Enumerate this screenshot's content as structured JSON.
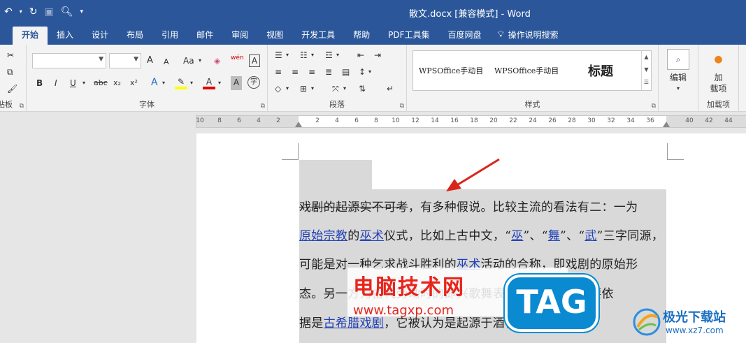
{
  "window": {
    "title": "散文.docx [兼容模式] - Word"
  },
  "qat": {
    "undo_icon": "undo-icon",
    "redo_icon": "redo-icon",
    "touch_icon": "touch-mode-icon",
    "preview_icon": "print-preview-icon",
    "customize_icon": "customize-qat-icon"
  },
  "tabs": [
    {
      "label": "开始",
      "active": true
    },
    {
      "label": "插入"
    },
    {
      "label": "设计"
    },
    {
      "label": "布局"
    },
    {
      "label": "引用"
    },
    {
      "label": "邮件"
    },
    {
      "label": "审阅"
    },
    {
      "label": "视图"
    },
    {
      "label": "开发工具"
    },
    {
      "label": "帮助"
    },
    {
      "label": "PDF工具集"
    },
    {
      "label": "百度网盘"
    },
    {
      "label": "操作说明搜索"
    }
  ],
  "ribbon": {
    "clipboard_label": "贴板",
    "font_label": "字体",
    "paragraph_label": "段落",
    "styles_label": "样式",
    "addins_label": "加载项",
    "font_name_value": "",
    "font_size_value": "",
    "grow_font": "A",
    "shrink_font": "A",
    "change_case": "Aa",
    "phonetic": "wén",
    "bold": "B",
    "italic": "I",
    "underline": "U",
    "strikethrough": "abc",
    "subscript": "x₂",
    "superscript": "x²",
    "text_effects": "A",
    "font_color": "A",
    "char_shading": "A",
    "enclose": "字",
    "char_border": "A",
    "styles": [
      "WPSOffice手动目",
      "WPSOffice手动目",
      "标题"
    ],
    "editing_label": "编辑",
    "addin_label_1": "加",
    "addin_label_2": "载项"
  },
  "ruler": {
    "ticks": [
      "10",
      "8",
      "6",
      "4",
      "2",
      "2",
      "4",
      "6",
      "8",
      "10",
      "12",
      "14",
      "16",
      "18",
      "20",
      "22",
      "24",
      "26",
      "28",
      "30",
      "32",
      "34",
      "36",
      "40",
      "42",
      "44"
    ]
  },
  "document": {
    "line1_strike": "戏剧的起源实不可考",
    "line1_rest": "，有多种假说。比较主流的看法有二：一为",
    "line2_link1": "原始宗教",
    "line2_t1": "的",
    "line2_link2": "巫术",
    "line2_t2": "仪式，比如上古中文，“",
    "line2_link3": "巫",
    "line2_t3": "”、“",
    "line2_link4": "舞",
    "line2_t4": "”、“",
    "line2_link5": "武",
    "line2_t5": "”三字同源，",
    "line3_t1": "可能是对一种乞求战斗胜利的",
    "line3_link": "巫术",
    "line3_t2": "活动的合称，即戏剧的原始形",
    "line4": "态。另一方为古代劳动时的即兴歌舞表演，这种说法主要依",
    "line5_t1": "据是",
    "line5_link": "古希腊戏剧",
    "line5_t2": "，它被认为是起源于酒神祭祀"
  },
  "watermark": {
    "site_title": "电脑技术网",
    "site_url": "www.tagxp.com",
    "badge": "TAG",
    "logo_name": "极光下载站",
    "logo_url": "www.xz7.com"
  },
  "colors": {
    "title_bar": "#2b579a",
    "selection": "#d9d9d9",
    "link": "#1f3fb5",
    "watermark_red": "#e8241c",
    "badge_blue": "#0a8ad0"
  }
}
